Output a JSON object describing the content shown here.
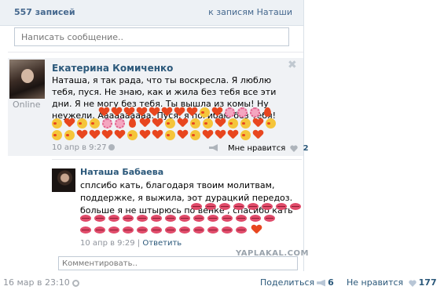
{
  "header": {
    "posts_count": "557 записей",
    "back_link": "к записям Наташи"
  },
  "compose": {
    "placeholder": "Написать сообщение.."
  },
  "post": {
    "author": "Екатерина Комиченко",
    "status": "Online",
    "text": "Наташа, я так рада, что ты воскресла. Я люблю тебя, пуся. Не знаю, как и жила без тебя все эти дни. Я не могу без тебя. Ты вышла из комы! Ну неужели. Аааааааааа. Пуся, я погибаю без тебя!",
    "date": "10 апр в 9:27",
    "like_label": "Мне нравится",
    "like_count": "2",
    "close_icon": "close-icon"
  },
  "reply": {
    "author": "Наташа Бабаева",
    "text": "сплсибо кать, благодаря твоим молитвам, поддержке, я выжила, эот дурацкий передоз. больше я не штырюсь по венке , спасибо кать",
    "date": "10 апр в 9:29",
    "separator": "|",
    "reply_link": "Ответить"
  },
  "comment": {
    "placeholder": "Комментировать.."
  },
  "watermark": "YAPLAKAL.COM",
  "footer": {
    "date": "16 мар в 23:10",
    "share_label": "Поделиться",
    "share_count": "6",
    "dislike_label": "Не нравится",
    "dislike_count": "177"
  },
  "colors": {
    "link": "#2b587a",
    "header_bg": "#edf1f5",
    "heart": "#e8461f",
    "muted": "#8f949c"
  }
}
